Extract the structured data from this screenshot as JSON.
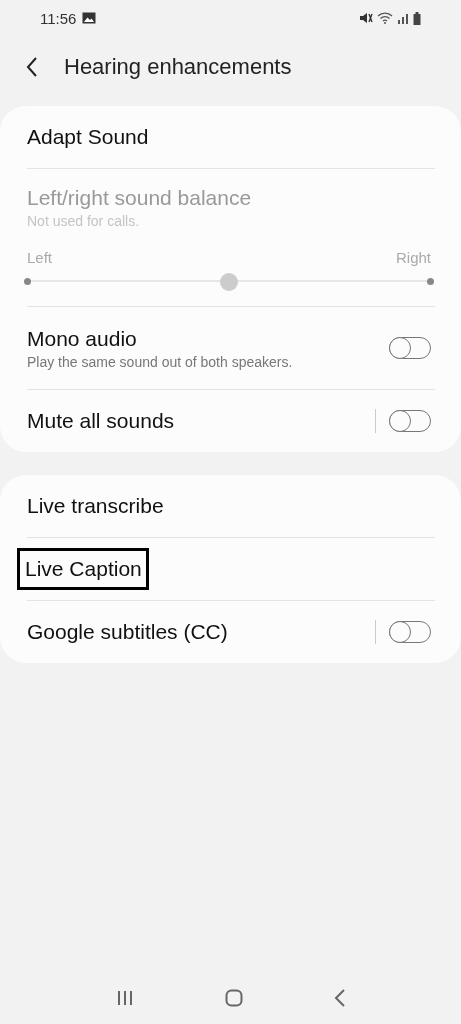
{
  "status_bar": {
    "time": "11:56"
  },
  "header": {
    "title": "Hearing enhancements"
  },
  "groups": [
    {
      "items": [
        {
          "kind": "link",
          "title": "Adapt Sound",
          "highlighted": false
        },
        {
          "kind": "balance",
          "title": "Left/right sound balance",
          "subtitle": "Not used for calls.",
          "disabled": true,
          "left_label": "Left",
          "right_label": "Right",
          "level": 0.5
        },
        {
          "kind": "switch",
          "title": "Mono audio",
          "subtitle": "Play the same sound out of both speakers.",
          "on": false,
          "divider": false
        },
        {
          "kind": "switch",
          "title": "Mute all sounds",
          "on": false,
          "divider": true
        }
      ]
    },
    {
      "items": [
        {
          "kind": "link",
          "title": "Live transcribe",
          "highlighted": false
        },
        {
          "kind": "link",
          "title": "Live Caption",
          "highlighted": true
        },
        {
          "kind": "switch",
          "title": "Google subtitles (CC)",
          "on": false,
          "divider": true
        }
      ]
    }
  ]
}
